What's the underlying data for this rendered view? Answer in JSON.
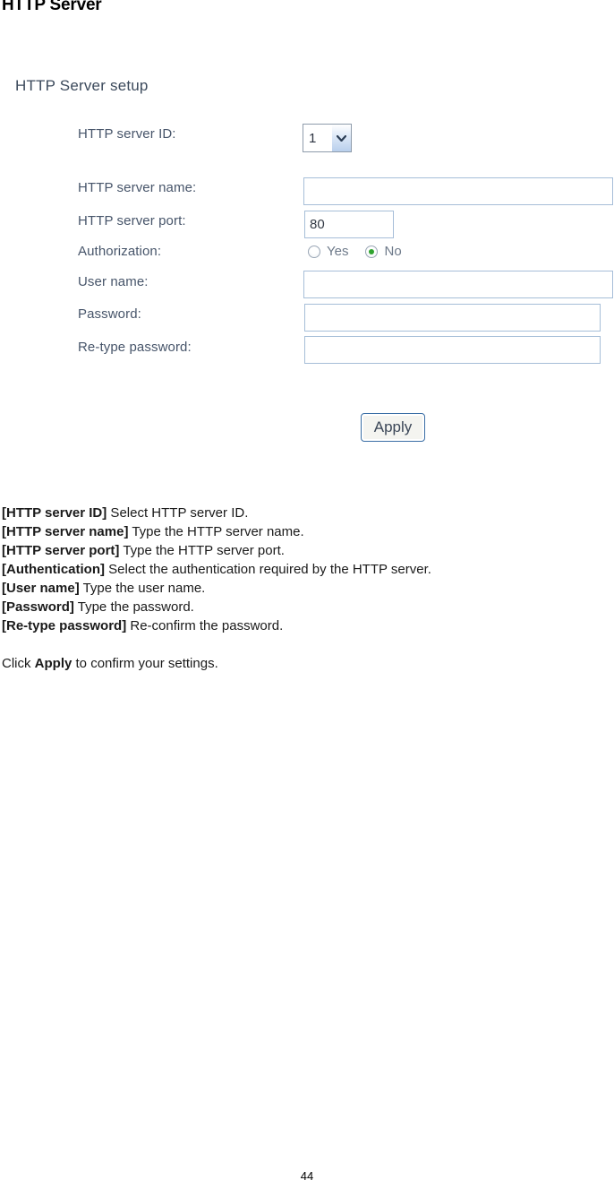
{
  "document": {
    "title": "HTTP Server",
    "page_number": "44"
  },
  "form": {
    "heading": "HTTP Server setup",
    "fields": {
      "server_id": {
        "label": "HTTP server ID:",
        "value": "1",
        "options": [
          "1"
        ],
        "arrow_icon": "chevron-down-icon"
      },
      "server_name": {
        "label": "HTTP server name:",
        "value": "",
        "placeholder": ""
      },
      "server_port": {
        "label": "HTTP server port:",
        "value": "80",
        "placeholder": ""
      },
      "authorization": {
        "label": "Authorization:",
        "options": [
          {
            "label": "Yes",
            "checked": false
          },
          {
            "label": "No",
            "checked": true
          }
        ],
        "selected": "No",
        "selected_dot_color": "#2fa32f"
      },
      "user_name": {
        "label": "User name:",
        "value": "",
        "placeholder": ""
      },
      "password": {
        "label": "Password:",
        "value": "",
        "placeholder": ""
      },
      "retype_password": {
        "label": "Re-type password:",
        "value": "",
        "placeholder": ""
      }
    },
    "apply_button": "Apply"
  },
  "description": {
    "lines": [
      {
        "term": "[HTTP server ID]",
        "text": " Select HTTP server ID."
      },
      {
        "term": "[HTTP server name]",
        "text": " Type the HTTP server name."
      },
      {
        "term": "[HTTP server port]",
        "text": " Type the HTTP server port."
      },
      {
        "term": "[Authentication]",
        "text": " Select the authentication required by the HTTP server."
      },
      {
        "term": "[User name]",
        "text": " Type the user name."
      },
      {
        "term": "[Password]",
        "text": " Type the password."
      },
      {
        "term": "[Re-type password]",
        "text": " Re-confirm the password."
      }
    ],
    "footer_prefix": "Click ",
    "footer_bold": "Apply",
    "footer_suffix": " to confirm your settings."
  },
  "theme": {
    "input_border": "#a6bed8",
    "label_color": "#47556a",
    "heading_color": "#3c4a5c",
    "button_border": "#3a6ea5"
  }
}
